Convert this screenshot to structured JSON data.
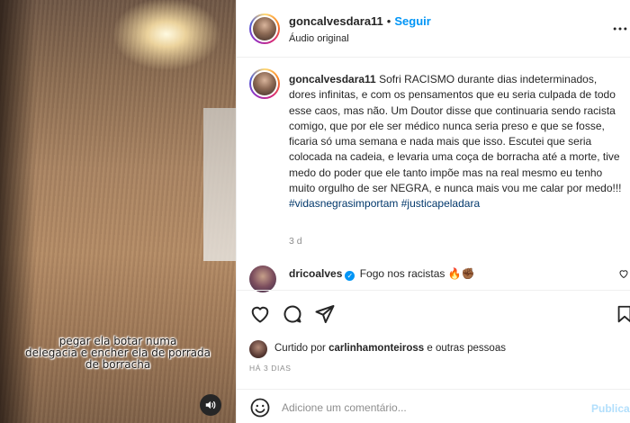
{
  "video": {
    "caption_lines": [
      "pegar ela botar numa",
      "delegacia e encher ela de porrada",
      "de borracha"
    ],
    "audio_icon": "speaker-icon"
  },
  "header": {
    "username": "goncalvesdara11",
    "separator": "•",
    "follow_label": "Seguir",
    "audio_label": "Áudio original",
    "more_icon": "more-horizontal-icon"
  },
  "post": {
    "username": "goncalvesdara11",
    "text": "Sofri RACISMO durante dias indeterminados, dores infinitas, e com os pensamentos que eu seria culpada de todo esse caos, mas não. Um Doutor disse que continuaria sendo racista comigo, que por ele ser médico nunca seria preso e que se fosse, ficaria só uma semana e nada mais que isso. Escutei que seria colocada na cadeia, e levaria uma coça de borracha até a morte, tive medo do poder que ele tanto impõe mas na real mesmo eu tenho muito orgulho de ser NEGRA, e nunca mais vou me calar por medo!!!",
    "hashtags": [
      "#vidasnegrasimportam",
      "#justicapeladara"
    ],
    "time": "3 d"
  },
  "comments": [
    {
      "username": "dricoalves",
      "verified": true,
      "text": "Fogo nos racistas 🔥✊🏾"
    }
  ],
  "actions": {
    "like_icon": "heart-icon",
    "comment_icon": "comment-icon",
    "share_icon": "send-icon",
    "save_icon": "bookmark-icon"
  },
  "likes": {
    "prefix": "Curtido por",
    "user": "carlinhamonteiross",
    "suffix": "e outras pessoas"
  },
  "date": "HÁ 3 DIAS",
  "add_comment": {
    "placeholder": "Adicione um comentário...",
    "publish_label": "Publicar"
  },
  "colors": {
    "accent": "#0095f6",
    "hashtag": "#00376b",
    "muted": "#8e8e8e",
    "publish_disabled": "#b2dffc"
  }
}
